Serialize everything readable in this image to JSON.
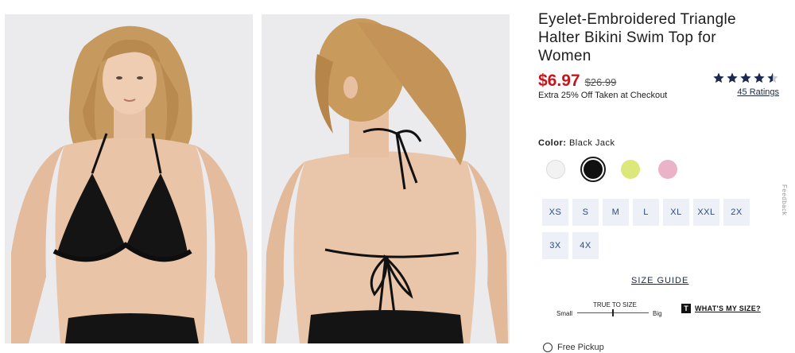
{
  "product": {
    "title": "Eyelet-Embroidered Triangle Halter Bikini Swim Top for Women",
    "sale_price": "$6.97",
    "original_price": "$26.99",
    "promo": "Extra 25% Off Taken at Checkout",
    "rating_value": 4.5,
    "ratings_label": "45 Ratings"
  },
  "color": {
    "label": "Color:",
    "selected": "Black Jack",
    "swatches": [
      {
        "name": "white",
        "hex": "#f2f2f2"
      },
      {
        "name": "black",
        "hex": "#111111",
        "selected": true
      },
      {
        "name": "lime",
        "hex": "#dde87a"
      },
      {
        "name": "pink",
        "hex": "#eab3c8"
      }
    ]
  },
  "sizes": [
    "XS",
    "S",
    "M",
    "L",
    "XL",
    "XXL",
    "2X",
    "3X",
    "4X"
  ],
  "size_guide": "SIZE GUIDE",
  "fit": {
    "title": "TRUE TO SIZE",
    "low": "Small",
    "high": "Big",
    "position": 0.5
  },
  "whats_my_size": {
    "icon_letter": "T",
    "label": "WHAT'S MY SIZE?"
  },
  "pickup": "Free Pickup",
  "feedback": "Feedback",
  "colors": {
    "sale": "#c5161d",
    "star": "#1b2a4e",
    "size_bg": "#edf0f6",
    "size_text": "#2a4a8a"
  }
}
